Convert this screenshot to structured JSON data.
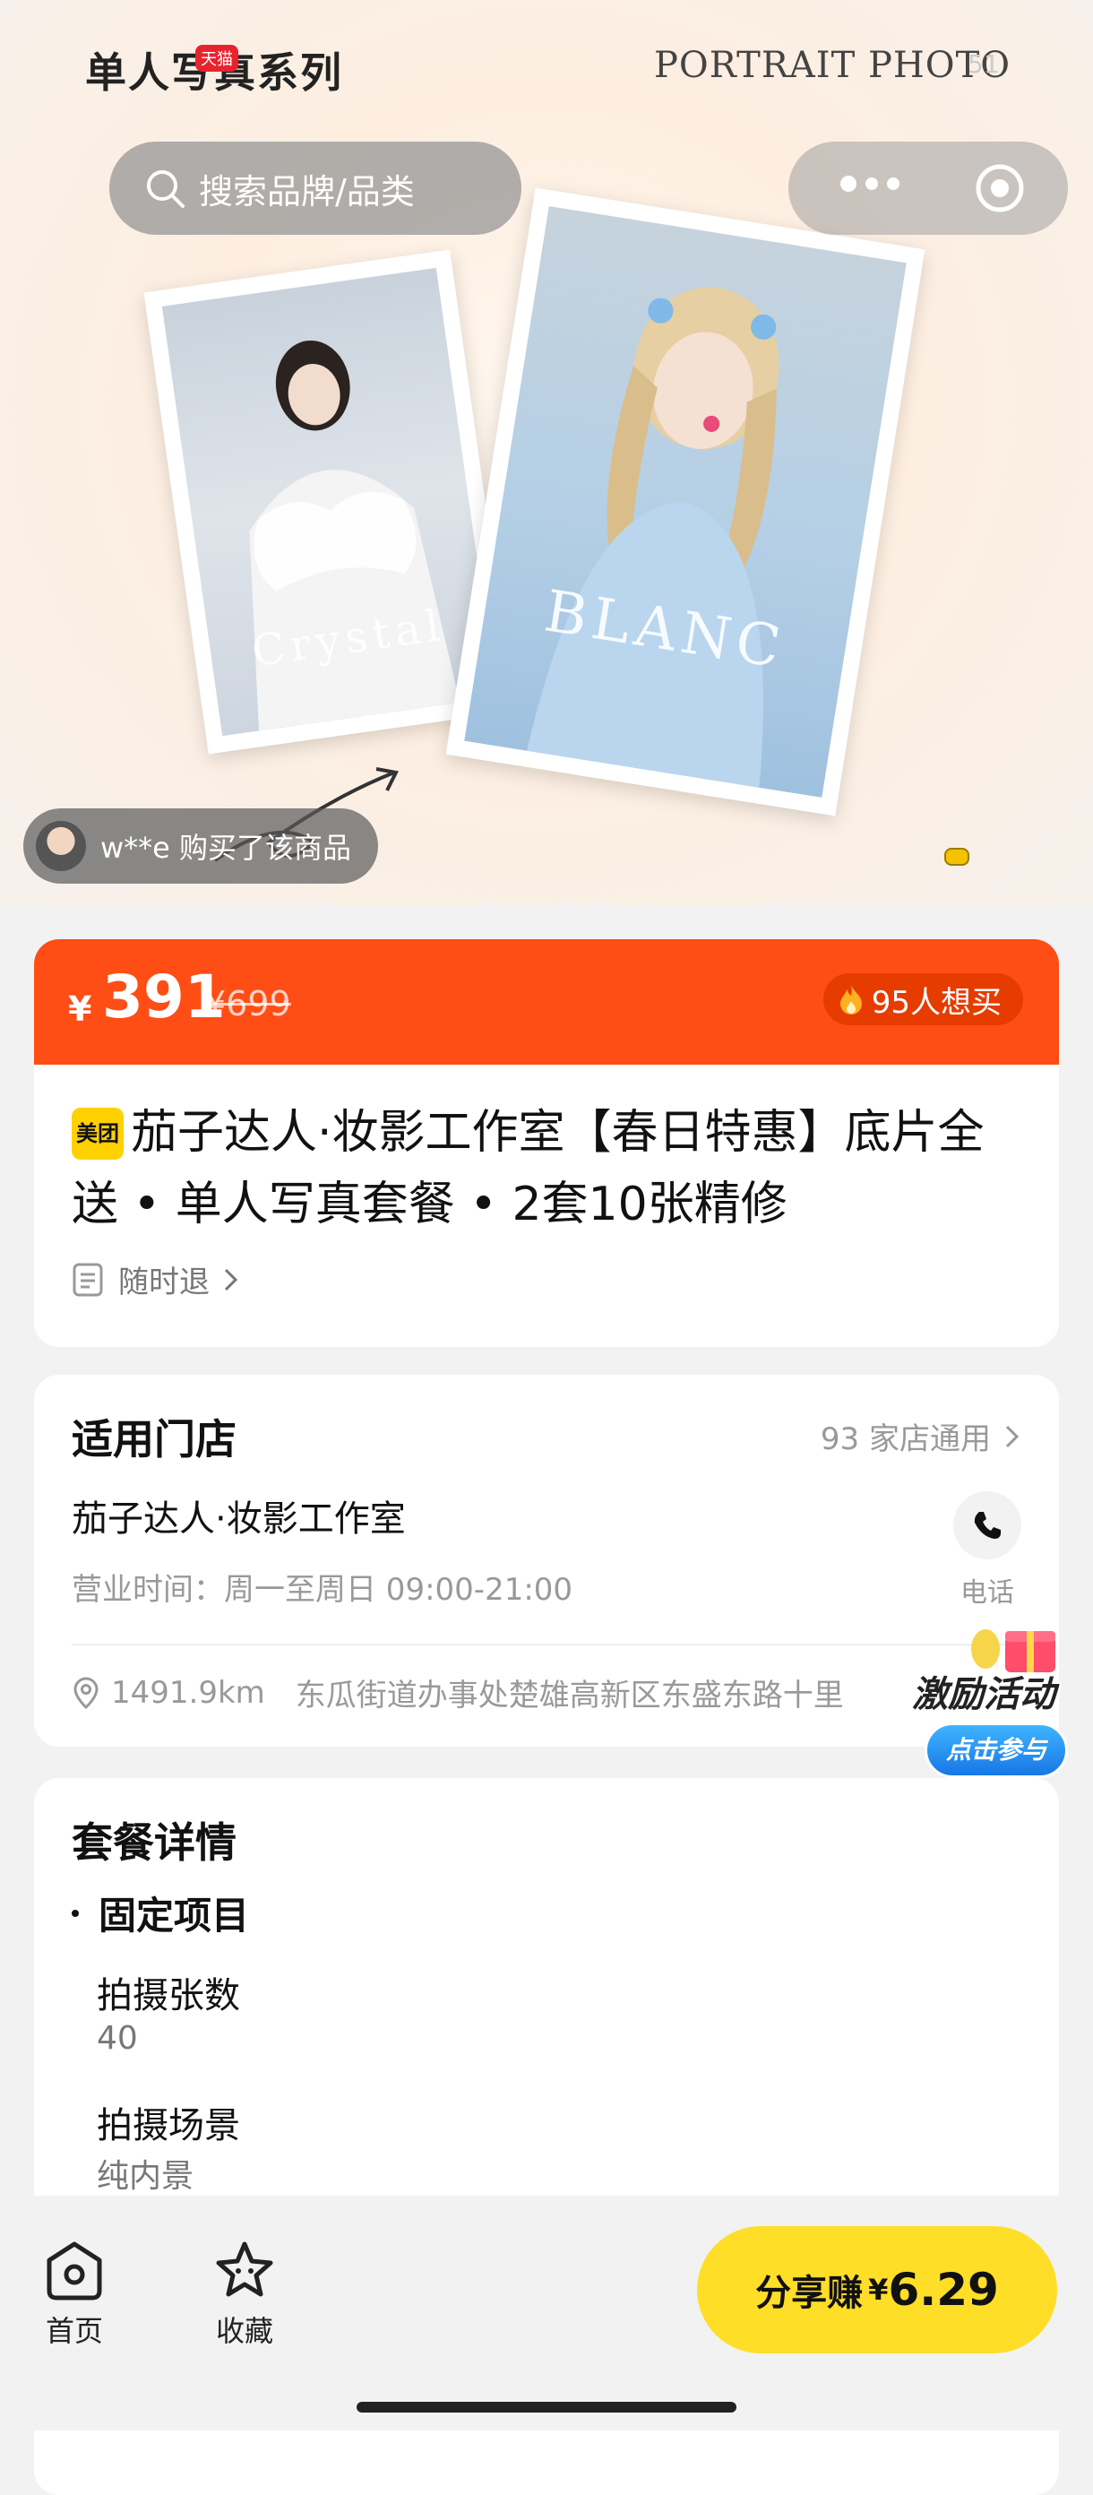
{
  "hero": {
    "title": "单人写真系列",
    "tmall_badge": "天猫",
    "subtitle": "PORTRAIT PHOTO",
    "subtitle_number": "51",
    "photo_left_caption": "Crystal",
    "photo_right_caption": "BLANC",
    "buyer_notice": "w**e 购买了该商品"
  },
  "search": {
    "placeholder": "搜索品牌/品类"
  },
  "price": {
    "currency": "¥",
    "current": "391",
    "original": "¥699",
    "want_count": "95人想买"
  },
  "product": {
    "badge": "美团",
    "title": "茄子达人·妆影工作室【春日特惠】底片全送 • 单人写真套餐 • 2套10张精修",
    "refund": "随时退"
  },
  "store": {
    "section_title": "适用门店",
    "count": "93 家店通用",
    "name": "茄子达人·妆影工作室",
    "hours": "营业时间：周一至周日 09:00-21:00",
    "phone_label": "电话",
    "distance": "1491.9km",
    "address": "东瓜街道办事处楚雄高新区东盛东路十里"
  },
  "promo": {
    "title": "激励活动",
    "button": "点击参与"
  },
  "package": {
    "section_title": "套餐详情",
    "group": "固定项目",
    "items": [
      {
        "label": "拍摄张数",
        "value": "40"
      },
      {
        "label": "拍摄场景",
        "value": "纯内景"
      }
    ]
  },
  "bottom_nav": {
    "home": "首页",
    "favorite": "收藏",
    "share_label": "分享赚",
    "share_currency": "¥",
    "share_amount": "6.29"
  },
  "colors": {
    "price_bar": "#ff4d16",
    "share_button": "#ffde27",
    "meituan_yellow": "#ffd100"
  }
}
